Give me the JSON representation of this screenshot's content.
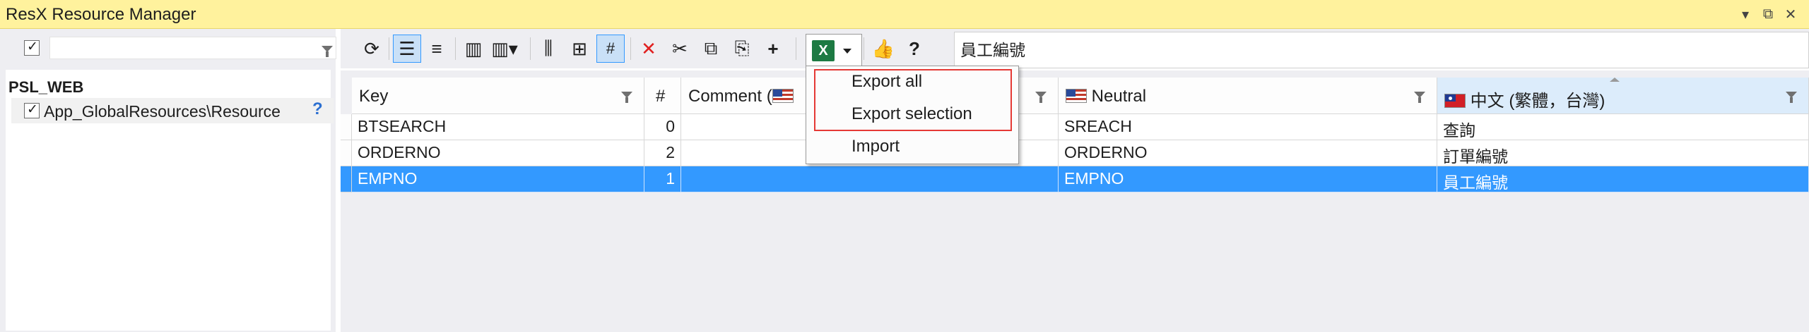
{
  "window": {
    "title": "ResX Resource Manager"
  },
  "tree": {
    "project": "PSL_WEB",
    "items": [
      {
        "label": "App_GlobalResources\\Resource",
        "help": "?"
      }
    ]
  },
  "toolbar": {
    "icons": [
      "refresh-icon",
      "align-justify-icon",
      "align-center-icon",
      "columns-icon",
      "columns-dropdown-icon",
      "add-column-icon",
      "hierarchy-icon",
      "hash-icon",
      "delete-icon",
      "cut-icon",
      "copy-icon",
      "paste-icon",
      "add-icon",
      "excel-icon",
      "like-icon",
      "help-icon"
    ],
    "hash_label": "#",
    "help_label": "?",
    "search_value": "員工編號"
  },
  "columns": [
    {
      "key": "key",
      "label": "Key"
    },
    {
      "key": "num",
      "label": "#"
    },
    {
      "key": "comment",
      "label": "Comment ("
    },
    {
      "key": "neutral",
      "label": "Neutral"
    },
    {
      "key": "zh",
      "label": "中文 (繁體，台灣)"
    }
  ],
  "rows": [
    {
      "key": "BTSEARCH",
      "num": "0",
      "comment": "",
      "neutral": "SREACH",
      "zh": "查詢"
    },
    {
      "key": "ORDERNO",
      "num": "2",
      "comment": "",
      "neutral": "ORDERNO",
      "zh": "訂單編號"
    },
    {
      "key": "EMPNO",
      "num": "1",
      "comment": "",
      "neutral": "EMPNO",
      "zh": "員工編號"
    }
  ],
  "excel_menu": {
    "items": [
      {
        "label": "Export all"
      },
      {
        "label": "Export selection"
      },
      {
        "label": "Import"
      }
    ]
  },
  "colors": {
    "title_bar": "#fff29d",
    "selection": "#3399ff",
    "highlight_box": "#e53935",
    "excel_green": "#1d7a43"
  }
}
